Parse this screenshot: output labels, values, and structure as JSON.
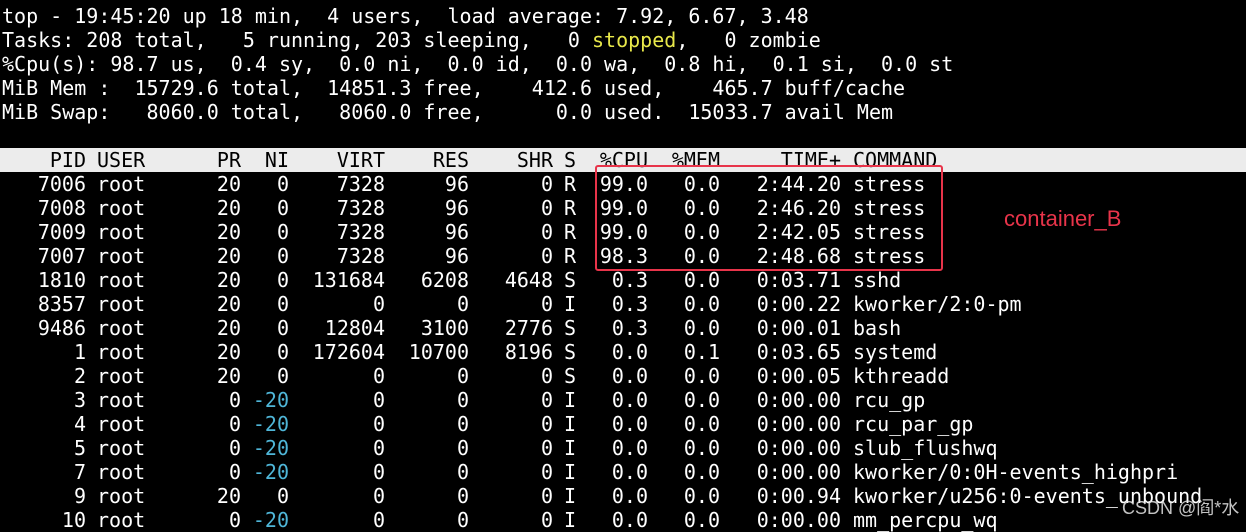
{
  "summary": {
    "top_line": "top - 19:45:20 up 18 min,  4 users,  load average: 7.92, 6.67, 3.48",
    "tasks_prefix": "Tasks: 208 total,   5 running, 203 sleeping,   0 ",
    "tasks_stopped": "stopped",
    "tasks_suffix": ",   0 zombie",
    "cpu_line": "%Cpu(s): 98.7 us,  0.4 sy,  0.0 ni,  0.0 id,  0.0 wa,  0.8 hi,  0.1 si,  0.0 st",
    "mem_line": "MiB Mem :  15729.6 total,  14851.3 free,    412.6 used,    465.7 buff/cache",
    "swap_line": "MiB Swap:   8060.0 total,   8060.0 free,      0.0 used.  15033.7 avail Mem"
  },
  "table": {
    "headers": {
      "pid": "PID",
      "user": "USER",
      "pr": "PR",
      "ni": "NI",
      "virt": "VIRT",
      "res": "RES",
      "shr": "SHR",
      "s": "S",
      "cpu": "%CPU",
      "mem": "%MEM",
      "time": "TIME+",
      "command": "COMMAND"
    },
    "rows": [
      {
        "pid": "7006",
        "user": "root",
        "pr": "20",
        "ni": "0",
        "virt": "7328",
        "res": "96",
        "shr": "0",
        "s": "R",
        "cpu": "99.0",
        "mem": "0.0",
        "time": "2:44.20",
        "command": "stress"
      },
      {
        "pid": "7008",
        "user": "root",
        "pr": "20",
        "ni": "0",
        "virt": "7328",
        "res": "96",
        "shr": "0",
        "s": "R",
        "cpu": "99.0",
        "mem": "0.0",
        "time": "2:46.20",
        "command": "stress"
      },
      {
        "pid": "7009",
        "user": "root",
        "pr": "20",
        "ni": "0",
        "virt": "7328",
        "res": "96",
        "shr": "0",
        "s": "R",
        "cpu": "99.0",
        "mem": "0.0",
        "time": "2:42.05",
        "command": "stress"
      },
      {
        "pid": "7007",
        "user": "root",
        "pr": "20",
        "ni": "0",
        "virt": "7328",
        "res": "96",
        "shr": "0",
        "s": "R",
        "cpu": "98.3",
        "mem": "0.0",
        "time": "2:48.68",
        "command": "stress"
      },
      {
        "pid": "1810",
        "user": "root",
        "pr": "20",
        "ni": "0",
        "virt": "131684",
        "res": "6208",
        "shr": "4648",
        "s": "S",
        "cpu": "0.3",
        "mem": "0.0",
        "time": "0:03.71",
        "command": "sshd"
      },
      {
        "pid": "8357",
        "user": "root",
        "pr": "20",
        "ni": "0",
        "virt": "0",
        "res": "0",
        "shr": "0",
        "s": "I",
        "cpu": "0.3",
        "mem": "0.0",
        "time": "0:00.22",
        "command": "kworker/2:0-pm"
      },
      {
        "pid": "9486",
        "user": "root",
        "pr": "20",
        "ni": "0",
        "virt": "12804",
        "res": "3100",
        "shr": "2776",
        "s": "S",
        "cpu": "0.3",
        "mem": "0.0",
        "time": "0:00.01",
        "command": "bash"
      },
      {
        "pid": "1",
        "user": "root",
        "pr": "20",
        "ni": "0",
        "virt": "172604",
        "res": "10700",
        "shr": "8196",
        "s": "S",
        "cpu": "0.0",
        "mem": "0.1",
        "time": "0:03.65",
        "command": "systemd"
      },
      {
        "pid": "2",
        "user": "root",
        "pr": "20",
        "ni": "0",
        "virt": "0",
        "res": "0",
        "shr": "0",
        "s": "S",
        "cpu": "0.0",
        "mem": "0.0",
        "time": "0:00.05",
        "command": "kthreadd"
      },
      {
        "pid": "3",
        "user": "root",
        "pr": "0",
        "ni": "-20",
        "virt": "0",
        "res": "0",
        "shr": "0",
        "s": "I",
        "cpu": "0.0",
        "mem": "0.0",
        "time": "0:00.00",
        "command": "rcu_gp"
      },
      {
        "pid": "4",
        "user": "root",
        "pr": "0",
        "ni": "-20",
        "virt": "0",
        "res": "0",
        "shr": "0",
        "s": "I",
        "cpu": "0.0",
        "mem": "0.0",
        "time": "0:00.00",
        "command": "rcu_par_gp"
      },
      {
        "pid": "5",
        "user": "root",
        "pr": "0",
        "ni": "-20",
        "virt": "0",
        "res": "0",
        "shr": "0",
        "s": "I",
        "cpu": "0.0",
        "mem": "0.0",
        "time": "0:00.00",
        "command": "slub_flushwq"
      },
      {
        "pid": "7",
        "user": "root",
        "pr": "0",
        "ni": "-20",
        "virt": "0",
        "res": "0",
        "shr": "0",
        "s": "I",
        "cpu": "0.0",
        "mem": "0.0",
        "time": "0:00.00",
        "command": "kworker/0:0H-events_highpri"
      },
      {
        "pid": "9",
        "user": "root",
        "pr": "20",
        "ni": "0",
        "virt": "0",
        "res": "0",
        "shr": "0",
        "s": "I",
        "cpu": "0.0",
        "mem": "0.0",
        "time": "0:00.94",
        "command": "kworker/u256:0-events_unbound"
      },
      {
        "pid": "10",
        "user": "root",
        "pr": "0",
        "ni": "-20",
        "virt": "0",
        "res": "0",
        "shr": "0",
        "s": "I",
        "cpu": "0.0",
        "mem": "0.0",
        "time": "0:00.00",
        "command": "mm_percpu_wq"
      }
    ]
  },
  "annotation": {
    "label": "container_B",
    "color": "#e8344a"
  },
  "watermark": "CSDN @阎*水",
  "colors": {
    "stopped": "#e8e84a",
    "negative_ni": "#4fb6d8",
    "header_bg": "#ececec"
  }
}
